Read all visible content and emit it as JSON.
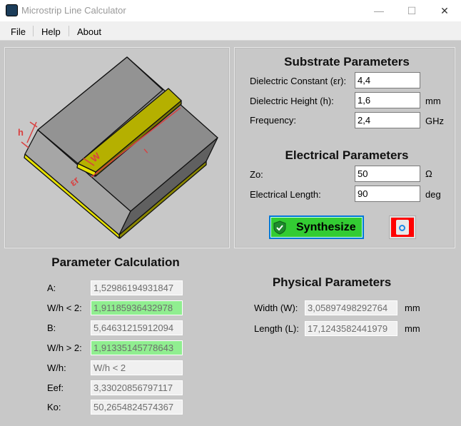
{
  "window": {
    "title": "Microstrip Line Calculator",
    "minimize": "—",
    "maximize": "☐",
    "close": "✕"
  },
  "menu": [
    "File",
    "Help",
    "About"
  ],
  "diagram": {
    "labels": {
      "h": "h",
      "w": "W",
      "l": "l",
      "er": "εr"
    },
    "colors": {
      "substrate": "#8c8c8c",
      "conductor": "#b5b000",
      "ground": "#e6e000",
      "dimension": "#d94040"
    }
  },
  "substrate": {
    "title": "Substrate Parameters",
    "fields": [
      {
        "label": "Dielectric Constant (εr):",
        "value": "4,4",
        "unit": ""
      },
      {
        "label": "Dielectric Height (h):",
        "value": "1,6",
        "unit": "mm"
      },
      {
        "label": "Frequency:",
        "value": "2,4",
        "unit": "GHz"
      }
    ]
  },
  "electrical": {
    "title": "Electrical Parameters",
    "fields": [
      {
        "label": "Zo:",
        "value": "50",
        "unit": "Ω"
      },
      {
        "label": "Electrical Length:",
        "value": "90",
        "unit": "deg"
      }
    ]
  },
  "actions": {
    "synthesize": "Synthesize",
    "synthesize_color": "#33cc33",
    "clear_color": "#ff0000"
  },
  "calc": {
    "title": "Parameter Calculation",
    "rows": [
      {
        "label": "A:",
        "value": "1,52986194931847",
        "highlight": false
      },
      {
        "label": "W/h < 2:",
        "value": "1,91185936432978",
        "highlight": true
      },
      {
        "label": "B:",
        "value": "5,64631215912094",
        "highlight": false
      },
      {
        "label": "W/h > 2:",
        "value": "1,91335145778643",
        "highlight": true
      },
      {
        "label": "W/h:",
        "value": "W/h < 2",
        "highlight": false
      },
      {
        "label": "Eef:",
        "value": "3,33020856797117",
        "highlight": false
      },
      {
        "label": "Ko:",
        "value": "50,2654824574367",
        "highlight": false
      }
    ]
  },
  "physical": {
    "title": "Physical Parameters",
    "rows": [
      {
        "label": "Width (W):",
        "value": "3,05897498292764",
        "unit": "mm"
      },
      {
        "label": "Length (L):",
        "value": "17,1243582441979",
        "unit": "mm"
      }
    ]
  }
}
